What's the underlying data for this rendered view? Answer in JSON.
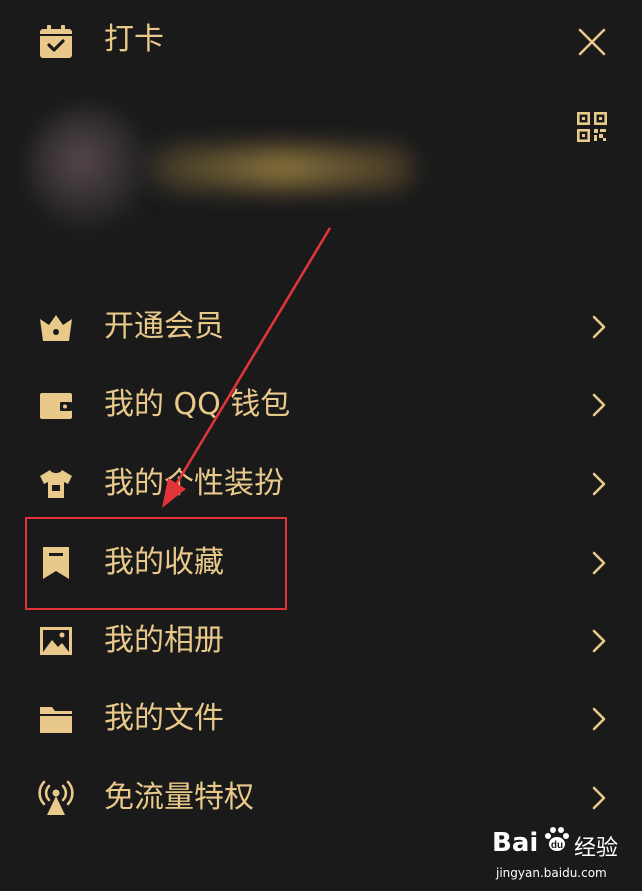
{
  "header": {
    "checkin_label": "打卡",
    "checkin_icon": "calendar-check-icon",
    "close_icon": "close-icon"
  },
  "profile": {
    "qr_icon": "qr-code-icon"
  },
  "menu": {
    "items": [
      {
        "label": "开通会员",
        "icon": "crown-icon"
      },
      {
        "label": "我的 QQ 钱包",
        "icon": "wallet-icon"
      },
      {
        "label": "我的个性装扮",
        "icon": "tshirt-icon"
      },
      {
        "label": "我的收藏",
        "icon": "bookmark-icon"
      },
      {
        "label": "我的相册",
        "icon": "image-icon"
      },
      {
        "label": "我的文件",
        "icon": "folder-icon"
      },
      {
        "label": "免流量特权",
        "icon": "signal-tower-icon"
      }
    ]
  },
  "watermark": {
    "logo": "Bai",
    "logo_suffix": "经验",
    "url": "jingyan.baidu.com"
  },
  "colors": {
    "background": "#1a1a1b",
    "accent_gold": "#e8c98a",
    "annotation_red": "#e0343a"
  }
}
